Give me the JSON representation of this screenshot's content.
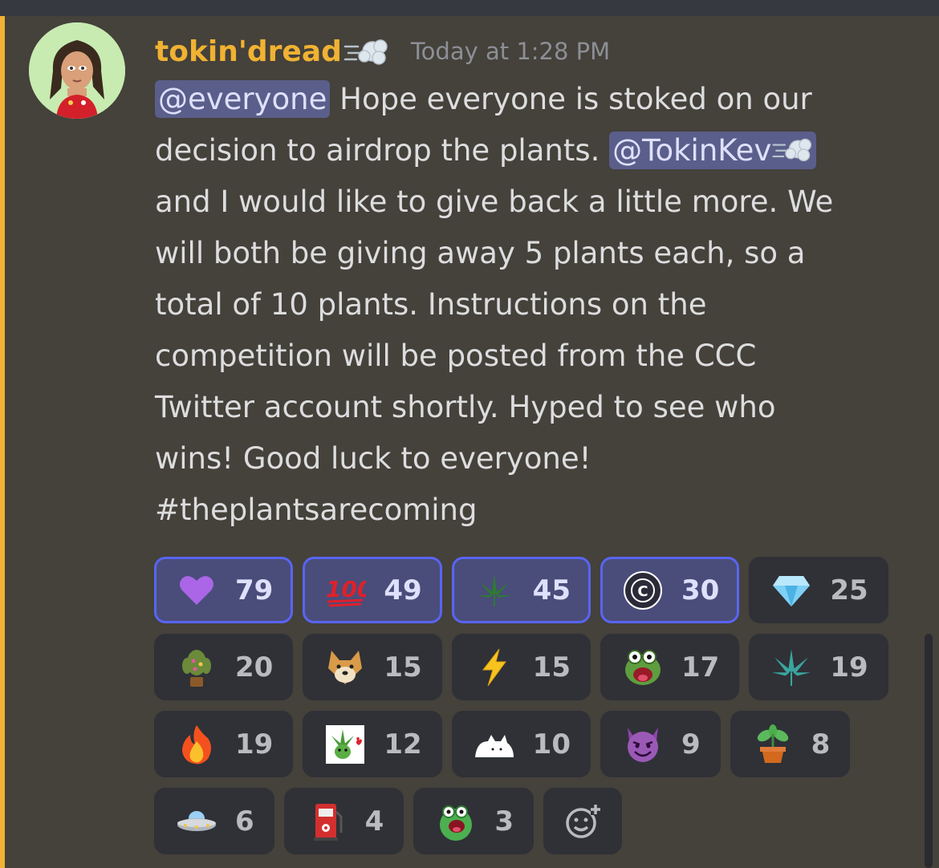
{
  "message": {
    "username": "tokin'dread",
    "timestamp": "Today at 1:28 PM",
    "mention_everyone": "@everyone",
    "line1_rest": " Hope everyone is stoked on our",
    "line2_pre": "decision to airdrop the plants. ",
    "mention_user": "@TokinKev",
    "line3": "and I would like to give back a little more. We",
    "line4": "will both be giving away 5 plants each, so a",
    "line5": "total of 10 plants. Instructions on the",
    "line6": "competition will be posted from the CCC",
    "line7": "Twitter account shortly. Hyped to see who",
    "line8": "wins! Good luck to everyone!",
    "line9": "#theplantsarecoming"
  },
  "reactions": [
    {
      "emoji": "purple-heart",
      "count": "79",
      "reacted": true
    },
    {
      "emoji": "hundred-points",
      "count": "49",
      "reacted": true
    },
    {
      "emoji": "cannabis-leaf-dark",
      "count": "45",
      "reacted": true
    },
    {
      "emoji": "crypto-cannabis-club-logo",
      "count": "30",
      "reacted": true
    },
    {
      "emoji": "gem",
      "count": "25",
      "reacted": false
    },
    {
      "emoji": "plant-creature",
      "count": "20",
      "reacted": false
    },
    {
      "emoji": "doge",
      "count": "15",
      "reacted": false
    },
    {
      "emoji": "lightning",
      "count": "15",
      "reacted": false
    },
    {
      "emoji": "pepe-screaming",
      "count": "17",
      "reacted": false
    },
    {
      "emoji": "cannabis-leaf",
      "count": "19",
      "reacted": false
    },
    {
      "emoji": "fire",
      "count": "19",
      "reacted": false
    },
    {
      "emoji": "leaf-heart",
      "count": "12",
      "reacted": false
    },
    {
      "emoji": "cat-peek",
      "count": "10",
      "reacted": false
    },
    {
      "emoji": "smiling-imp",
      "count": "9",
      "reacted": false
    },
    {
      "emoji": "potted-plant",
      "count": "8",
      "reacted": false
    },
    {
      "emoji": "ufo",
      "count": "6",
      "reacted": false
    },
    {
      "emoji": "fuel-pump",
      "count": "4",
      "reacted": false
    },
    {
      "emoji": "pepe-green",
      "count": "3",
      "reacted": false
    }
  ],
  "colors": {
    "background": "#45413b",
    "username": "#f0b232",
    "mention_bg": "#5a5e8a",
    "reacted_border": "#5865f2"
  }
}
